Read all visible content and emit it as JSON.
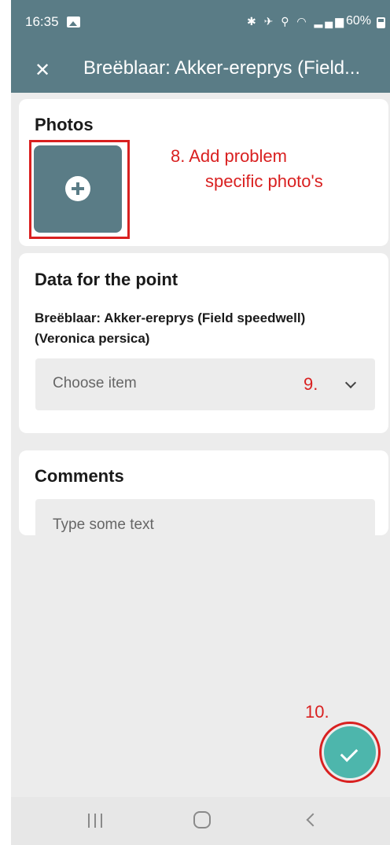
{
  "status_bar": {
    "time": "16:35",
    "icons": "✱ ✈ ⚲ ◠ ▂▄▆",
    "battery": "60%"
  },
  "app_bar": {
    "close_label": "✕",
    "title": "Breëblaar: Akker-ereprys (Field..."
  },
  "photos": {
    "title": "Photos",
    "annotation_line1": "8. Add problem",
    "annotation_line2": "specific photo's"
  },
  "data_point": {
    "title": "Data for the point",
    "point_name": "Breëblaar: Akker-ereprys (Field speedwell) (Veronica persica)",
    "select_placeholder": "Choose item",
    "annotation": "9."
  },
  "comments": {
    "title": "Comments",
    "placeholder": "Type some text"
  },
  "fab": {
    "annotation": "10."
  },
  "colors": {
    "app_bar": "#5a7c86",
    "fab": "#4db6ac",
    "annotation": "#d92020",
    "background": "#ececec"
  },
  "icons": {
    "close": "close-icon",
    "add_photo": "plus-icon",
    "dropdown": "chevron-down-icon",
    "submit": "check-icon",
    "nav_recents": "recents-icon",
    "nav_home": "home-icon",
    "nav_back": "back-icon"
  }
}
